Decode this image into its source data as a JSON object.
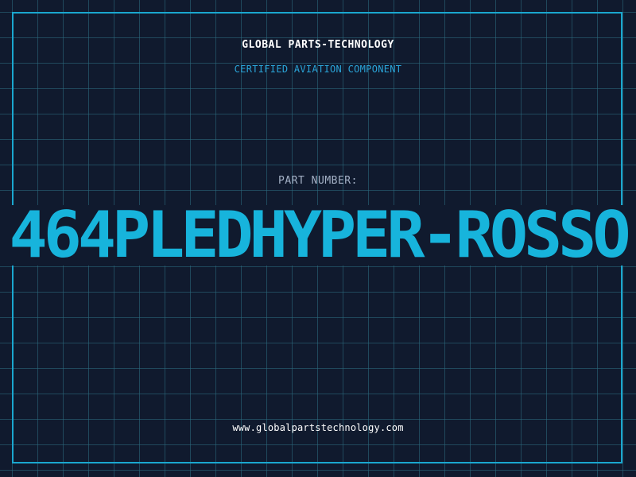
{
  "header": {
    "company": "GLOBAL PARTS-TECHNOLOGY",
    "tagline": "CERTIFIED AVIATION COMPONENT"
  },
  "part": {
    "label": "PART NUMBER:",
    "number": "464PLEDHYPER-ROSSO"
  },
  "footer": {
    "website": "www.globalpartstechnology.com"
  },
  "colors": {
    "background": "#101a2e",
    "accent": "#17b4dc",
    "grid": "#2d6e82",
    "frame": "#1aa7cf",
    "label": "#a4b1c6",
    "text": "#ffffff"
  }
}
